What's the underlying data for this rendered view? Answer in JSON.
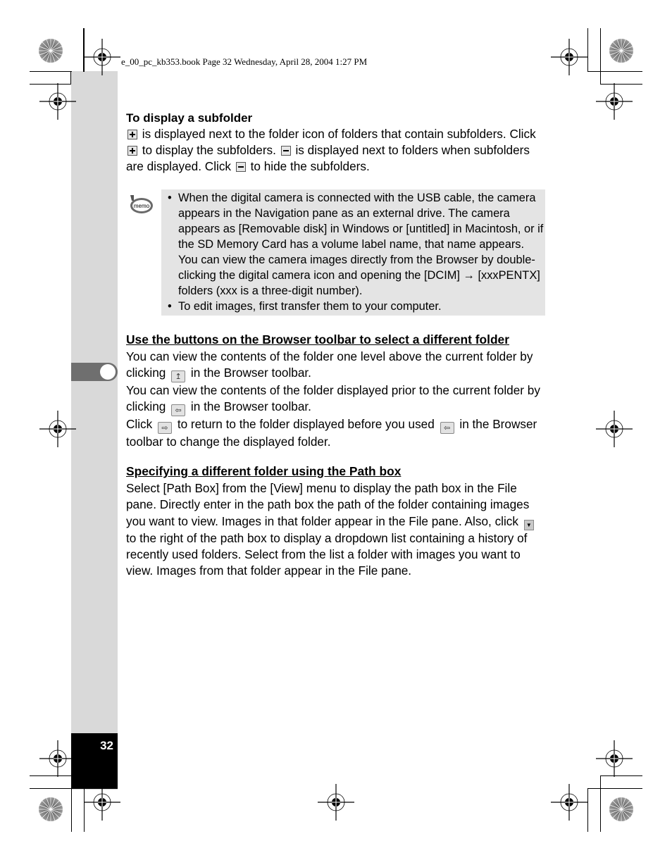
{
  "header": {
    "file_line": "e_00_pc_kb353.book  Page 32  Wednesday, April 28, 2004  1:27 PM"
  },
  "page_number": "32",
  "subfolder_section": {
    "title": "To display a subfolder",
    "line1": "is displayed next to the folder icon of folders that contain subfolders.",
    "line2_a": "Click",
    "line2_b": "to display the subfolders.",
    "line2_c": "is displayed next to folders when subfolders are displayed. Click",
    "line2_d": "to hide the subfolders."
  },
  "memo": {
    "icon_label": "memo",
    "items": [
      "When the digital camera is connected with the USB cable, the camera appears in the Navigation pane as an external drive. The camera appears as [Removable disk] in Windows or [untitled] in Macintosh, or if the SD Memory Card has a volume label name, that name appears. You can view the camera images directly from the Browser by double-clicking the digital camera icon and opening the [DCIM] → [xxxPENTX] folders (xxx is a three-digit number).",
      "To edit images, first transfer them to your computer."
    ]
  },
  "toolbar_section": {
    "title": "Use the buttons on the Browser toolbar to select a different folder",
    "p1_a": "You can view the contents of the folder one level above the current folder by clicking",
    "p1_b": "in the Browser toolbar.",
    "p2_a": "You can view the contents of the folder displayed prior to the current folder by clicking",
    "p2_b": "in the Browser toolbar.",
    "p3_a": "Click",
    "p3_b": "to return to the folder displayed before you used",
    "p3_c": "in the Browser toolbar to change the displayed folder."
  },
  "pathbox_section": {
    "title": "Specifying a different folder using the Path box",
    "p1_a": "Select [Path Box] from the [View] menu to display the path box in the File pane. Directly enter in the path box the path of the folder containing images you want to view. Images in that folder appear in the File pane. Also, click",
    "p1_b": "to the right of the path box to display a dropdown list containing a history of recently used folders. Select from the list a folder with images you want to view. Images from that folder appear in the File pane."
  },
  "icons": {
    "expand": "plus-box-icon",
    "collapse": "minus-box-icon",
    "up_folder": "up-folder-icon",
    "back": "back-folder-icon",
    "forward": "forward-folder-icon",
    "dropdown": "dropdown-arrow-icon"
  }
}
